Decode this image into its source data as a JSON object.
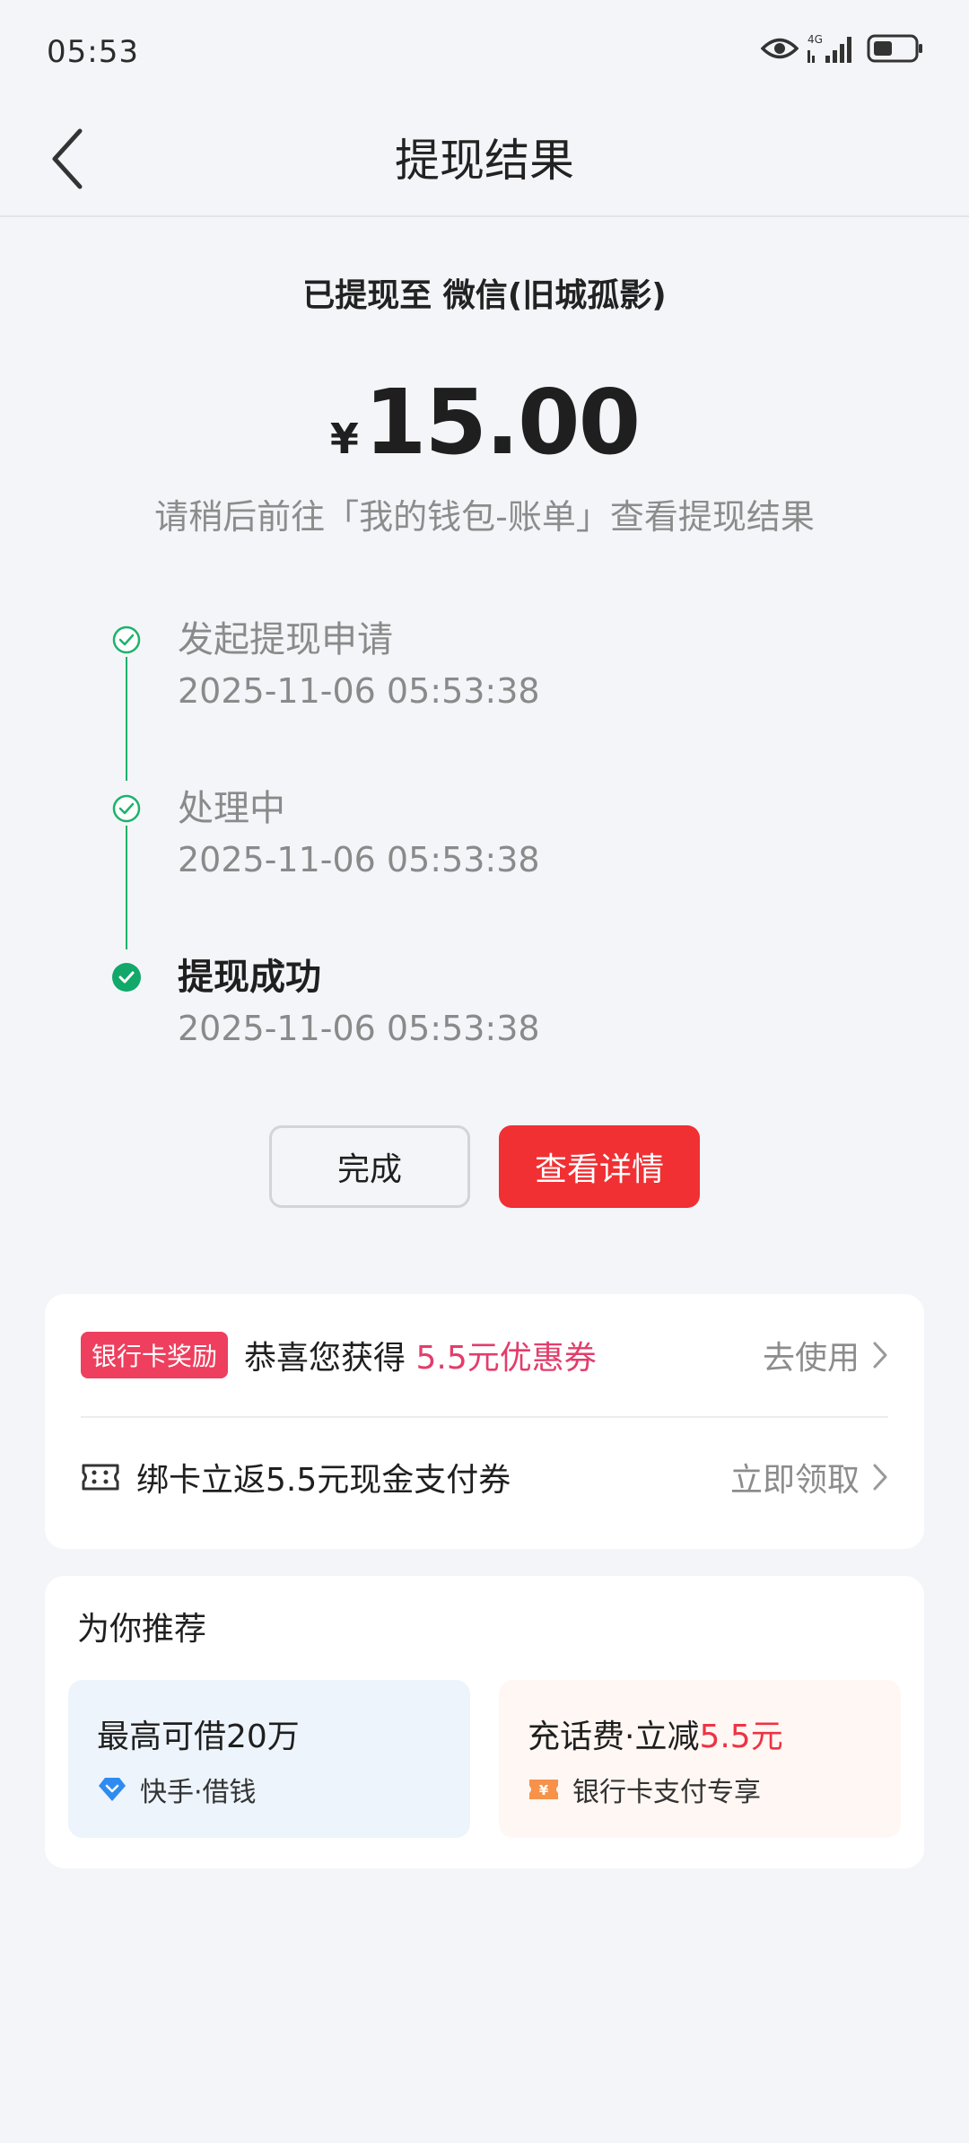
{
  "status": {
    "time": "05:53",
    "network": "4G"
  },
  "nav": {
    "title": "提现结果"
  },
  "result": {
    "destination": "已提现至 微信(旧城孤影)",
    "currency": "¥",
    "amount": "15.00",
    "hint": "请稍后前往「我的钱包-账单」查看提现结果"
  },
  "timeline": [
    {
      "title": "发起提现申请",
      "time": "2025-11-06 05:53:38"
    },
    {
      "title": "处理中",
      "time": "2025-11-06 05:53:38"
    },
    {
      "title": "提现成功",
      "time": "2025-11-06 05:53:38"
    }
  ],
  "buttons": {
    "done": "完成",
    "detail": "查看详情"
  },
  "promo": {
    "badge": "银行卡奖励",
    "text_prefix": "恭喜您获得 ",
    "text_highlight": "5.5元优惠券",
    "action": "去使用",
    "bind_text": "绑卡立返5.5元现金支付券",
    "bind_action": "立即领取"
  },
  "recommend": {
    "title": "为你推荐",
    "tiles": [
      {
        "title": "最高可借20万",
        "title_highlight": "",
        "sub": "快手·借钱"
      },
      {
        "title": "充话费·立减",
        "title_highlight": "5.5元",
        "sub": "银行卡支付专享"
      }
    ]
  },
  "colors": {
    "accent_red": "#F03033",
    "success_green": "#1CB36B",
    "badge_pink": "#EE3F5E"
  }
}
